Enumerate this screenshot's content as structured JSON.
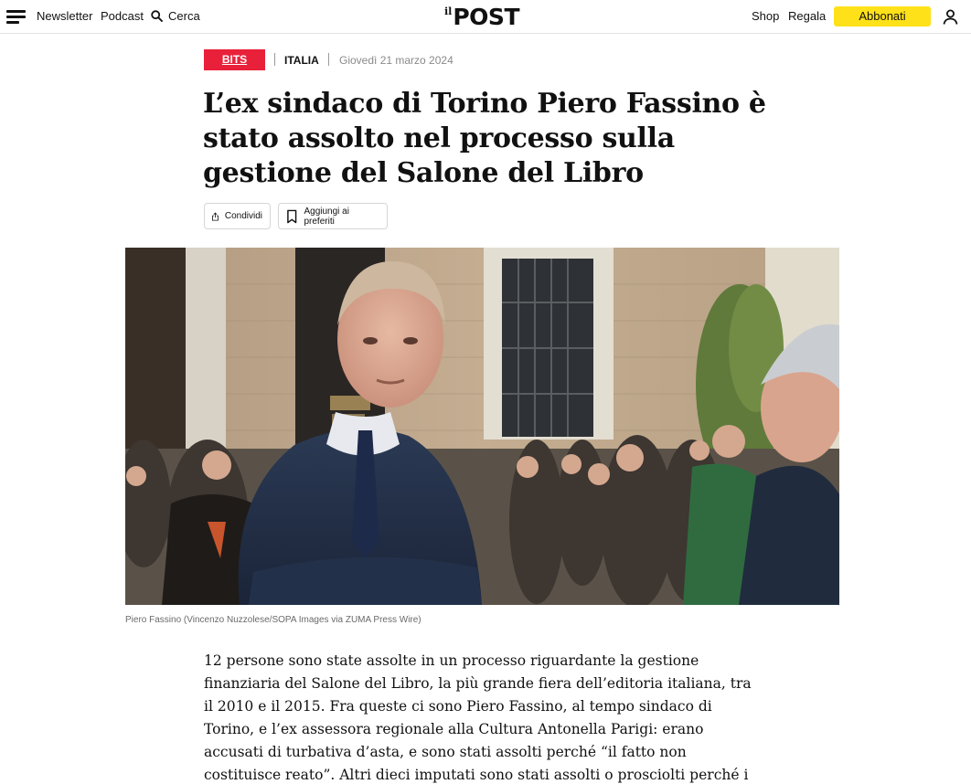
{
  "header": {
    "newsletter": "Newsletter",
    "podcast": "Podcast",
    "search": "Cerca",
    "logo_il": "il",
    "logo_post": "POST",
    "shop": "Shop",
    "regala": "Regala",
    "subscribe": "Abbonati"
  },
  "article": {
    "badge": "BITS",
    "section": "ITALIA",
    "date": "Giovedì 21 marzo 2024",
    "title": "L’ex sindaco di Torino Piero Fassino è stato assolto nel processo sulla gestione del Salone del Libro",
    "share_label": "Condividi",
    "favorite_label": "Aggiungi ai preferiti",
    "caption": "Piero Fassino (Vincenzo Nuzzolese/SOPA Images via ZUMA Press Wire)",
    "body": "12 persone sono state assolte in un processo riguardante la gestione finanziaria del Salone del Libro, la più grande fiera dell’editoria italiana, tra il 2010 e il 2015. Fra queste ci sono Piero Fassino, al tempo sindaco di Torino, e l’ex assessora regionale alla Cultura Antonella Parigi: erano accusati di turbativa d’asta, e sono stati assolti perché “il fatto non costituisce reato”. Altri dieci imputati sono stati assolti o prosciolti perché i reati di cui erano stati accusati erano andati in prescrizione."
  },
  "colors": {
    "badge": "#e9203a",
    "subscribe": "#ffe119"
  },
  "icons": [
    "menu-icon",
    "search-icon",
    "user-icon",
    "share-icon",
    "bookmark-icon"
  ]
}
